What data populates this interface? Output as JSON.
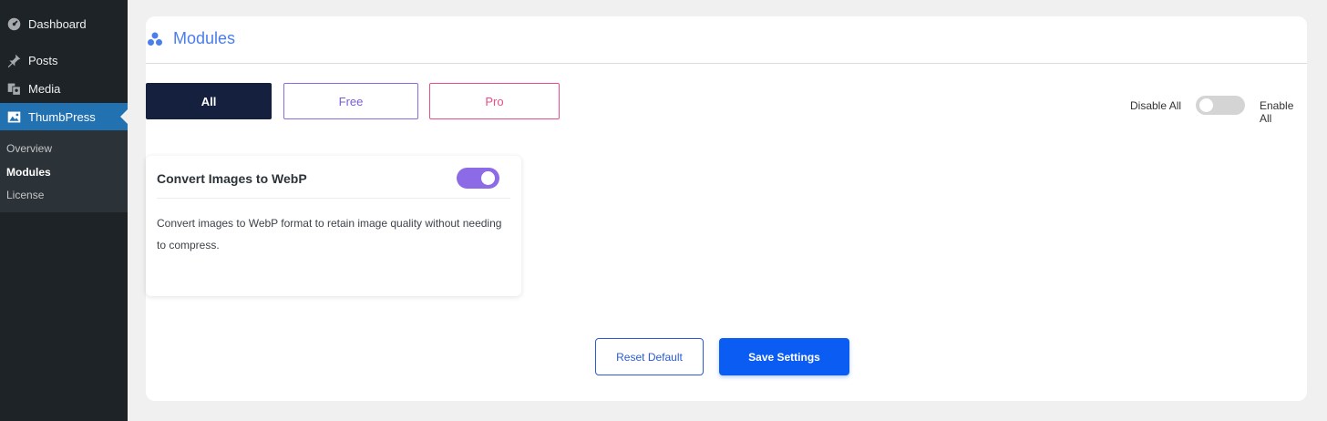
{
  "sidebar": {
    "items": [
      {
        "label": "Dashboard",
        "icon": "dashboard-icon"
      },
      {
        "label": "Posts",
        "icon": "pin-icon"
      },
      {
        "label": "Media",
        "icon": "media-icon"
      },
      {
        "label": "ThumbPress",
        "icon": "image-icon",
        "active": true
      }
    ],
    "submenu": [
      {
        "label": "Overview"
      },
      {
        "label": "Modules",
        "current": true
      },
      {
        "label": "License"
      }
    ]
  },
  "header": {
    "title": "Modules",
    "icon": "modules-icon"
  },
  "filters": {
    "all": "All",
    "free": "Free",
    "pro": "Pro"
  },
  "bulk_toggle": {
    "disable_label": "Disable All",
    "enable_label": "Enable All",
    "state": "off"
  },
  "module": {
    "title": "Convert Images to WebP",
    "description": "Convert images to WebP format to retain image quality without needing to compress.",
    "enabled": true
  },
  "actions": {
    "reset": "Reset Default",
    "save": "Save Settings"
  },
  "colors": {
    "primary": "#0b5cf3",
    "accent_purple": "#8e6be6",
    "accent_pink": "#ea4c89",
    "dark_navy": "#15203f",
    "wp_blue": "#2271b1"
  }
}
